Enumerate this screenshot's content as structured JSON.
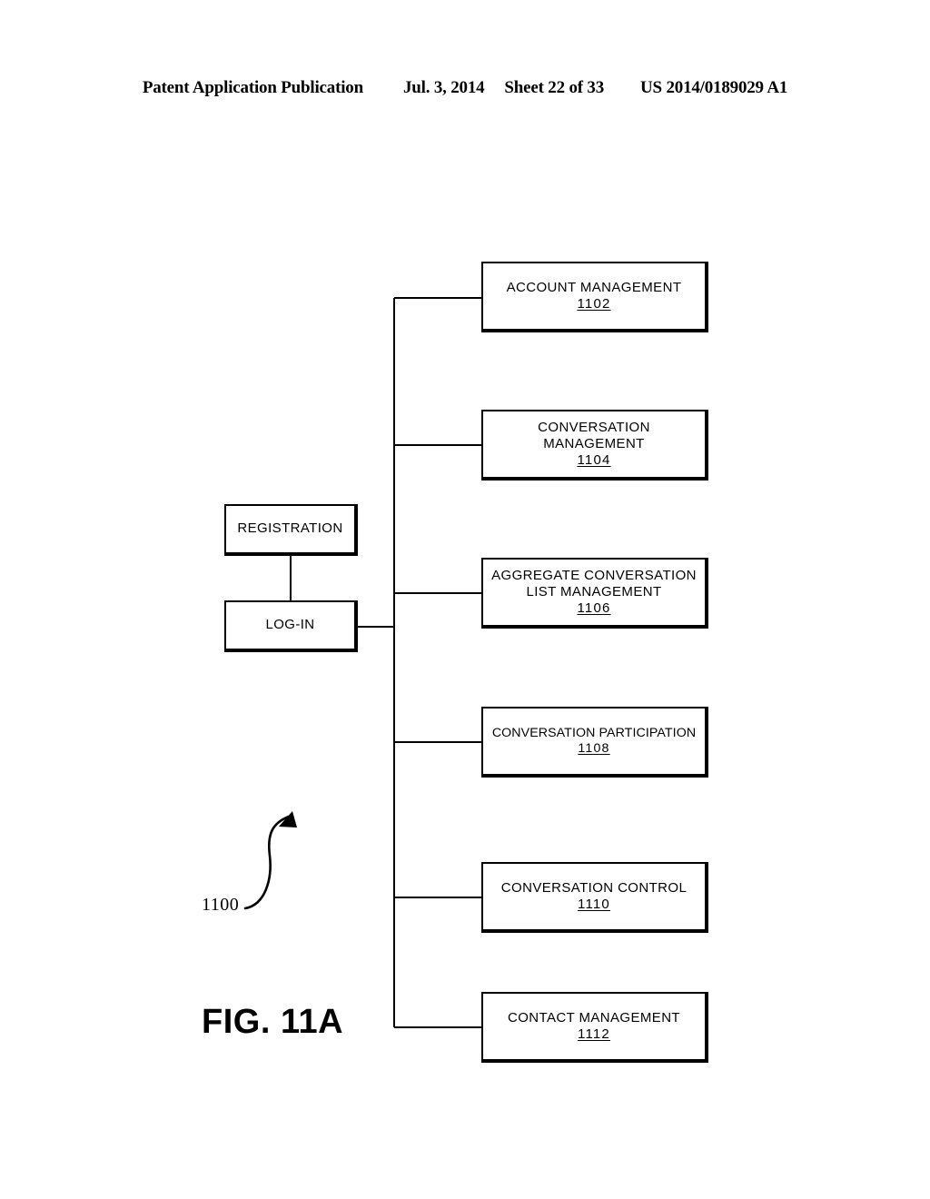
{
  "header": {
    "publication": "Patent Application Publication",
    "date": "Jul. 3, 2014",
    "sheet": "Sheet 22 of 33",
    "document_number": "US 2014/0189029 A1"
  },
  "figure": {
    "caption": "FIG. 11A",
    "reference_numeral": "1100"
  },
  "diagram": {
    "entry_nodes": [
      {
        "label": "REGISTRATION"
      },
      {
        "label": "LOG-IN"
      }
    ],
    "function_nodes": [
      {
        "line1": "ACCOUNT MANAGEMENT",
        "line2": "",
        "ref": "1102"
      },
      {
        "line1": "CONVERSATION",
        "line2": "MANAGEMENT",
        "ref": "1104"
      },
      {
        "line1": "AGGREGATE CONVERSATION",
        "line2": "LIST MANAGEMENT",
        "ref": "1106"
      },
      {
        "line1": "CONVERSATION PARTICIPATION",
        "line2": "",
        "ref": "1108"
      },
      {
        "line1": "CONVERSATION CONTROL",
        "line2": "",
        "ref": "1110"
      },
      {
        "line1": "CONTACT MANAGEMENT",
        "line2": "",
        "ref": "1112"
      }
    ]
  }
}
